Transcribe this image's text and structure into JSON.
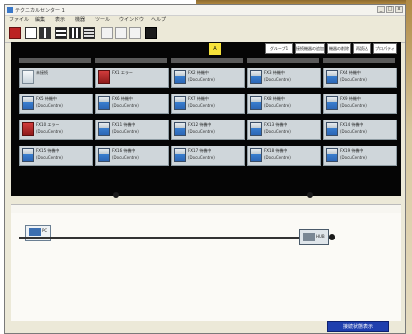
{
  "window": {
    "title": "テクニカルセンター 1",
    "min_label": "_",
    "max_label": "□",
    "close_label": "x"
  },
  "menu": [
    {
      "label": "ファイル"
    },
    {
      "label": "編集"
    },
    {
      "label": "表示"
    },
    {
      "label": "機器"
    },
    {
      "label": "ツール"
    },
    {
      "label": "ウインドウ"
    },
    {
      "label": "ヘルプ"
    }
  ],
  "toolbar_icons": [
    "printer-icon",
    "document-icon",
    "transfer-icon",
    "list-icon",
    "columns-icon",
    "grid-icon",
    "undo-icon",
    "redo-icon",
    "copy-icon",
    "save-icon"
  ],
  "strip": {
    "yellow_label": "A",
    "buttons": [
      "グループ1",
      "接続機器の追加",
      "機器の削除",
      "再読込",
      "プロパティ"
    ]
  },
  "tiles": [
    [
      {
        "icon": "light",
        "l1": "未接続",
        "l2": ""
      },
      {
        "icon": "red",
        "l1": "FX1 エラー",
        "l2": ""
      },
      {
        "icon": "printer",
        "l1": "FX2 待機中",
        "l2": "(DocuCentre)"
      },
      {
        "icon": "printer",
        "l1": "FX3 待機中",
        "l2": "(DocuCentre)"
      },
      {
        "icon": "printer",
        "l1": "FX4 待機中",
        "l2": "(DocuCentre)"
      }
    ],
    [
      {
        "icon": "printer",
        "l1": "FX5 待機中",
        "l2": "(DocuCentre)"
      },
      {
        "icon": "printer",
        "l1": "FX6 待機中",
        "l2": "(DocuCentre)"
      },
      {
        "icon": "printer",
        "l1": "FX7 待機中",
        "l2": "(DocuCentre)"
      },
      {
        "icon": "printer",
        "l1": "FX8 待機中",
        "l2": "(DocuCentre)"
      },
      {
        "icon": "printer",
        "l1": "FX9 待機中",
        "l2": "(DocuCentre)"
      }
    ],
    [
      {
        "icon": "red",
        "l1": "FX10 エラー",
        "l2": "(DocuCentre)"
      },
      {
        "icon": "printer",
        "l1": "FX11 待機中",
        "l2": "(DocuCentre)"
      },
      {
        "icon": "printer",
        "l1": "FX12 待機中",
        "l2": "(DocuCentre)"
      },
      {
        "icon": "printer",
        "l1": "FX13 待機中",
        "l2": "(DocuCentre)"
      },
      {
        "icon": "printer",
        "l1": "FX14 待機中",
        "l2": "(DocuCentre)"
      }
    ],
    [
      {
        "icon": "printer",
        "l1": "FX15 待機中",
        "l2": "(DocuCentre)"
      },
      {
        "icon": "printer",
        "l1": "FX16 待機中",
        "l2": "(DocuCentre)"
      },
      {
        "icon": "printer",
        "l1": "FX17 待機中",
        "l2": "(DocuCentre)"
      },
      {
        "icon": "printer",
        "l1": "FX18 待機中",
        "l2": "(DocuCentre)"
      },
      {
        "icon": "printer",
        "l1": "FX19 待機中",
        "l2": "(DocuCentre)"
      }
    ]
  ],
  "network": {
    "pc_label": "PC",
    "device_label": "HUB"
  },
  "status": {
    "label": "接続状態表示"
  },
  "colors": {
    "accent_blue": "#1f3fae",
    "highlight_yellow": "#f6e23a",
    "panel_black": "#050505"
  }
}
